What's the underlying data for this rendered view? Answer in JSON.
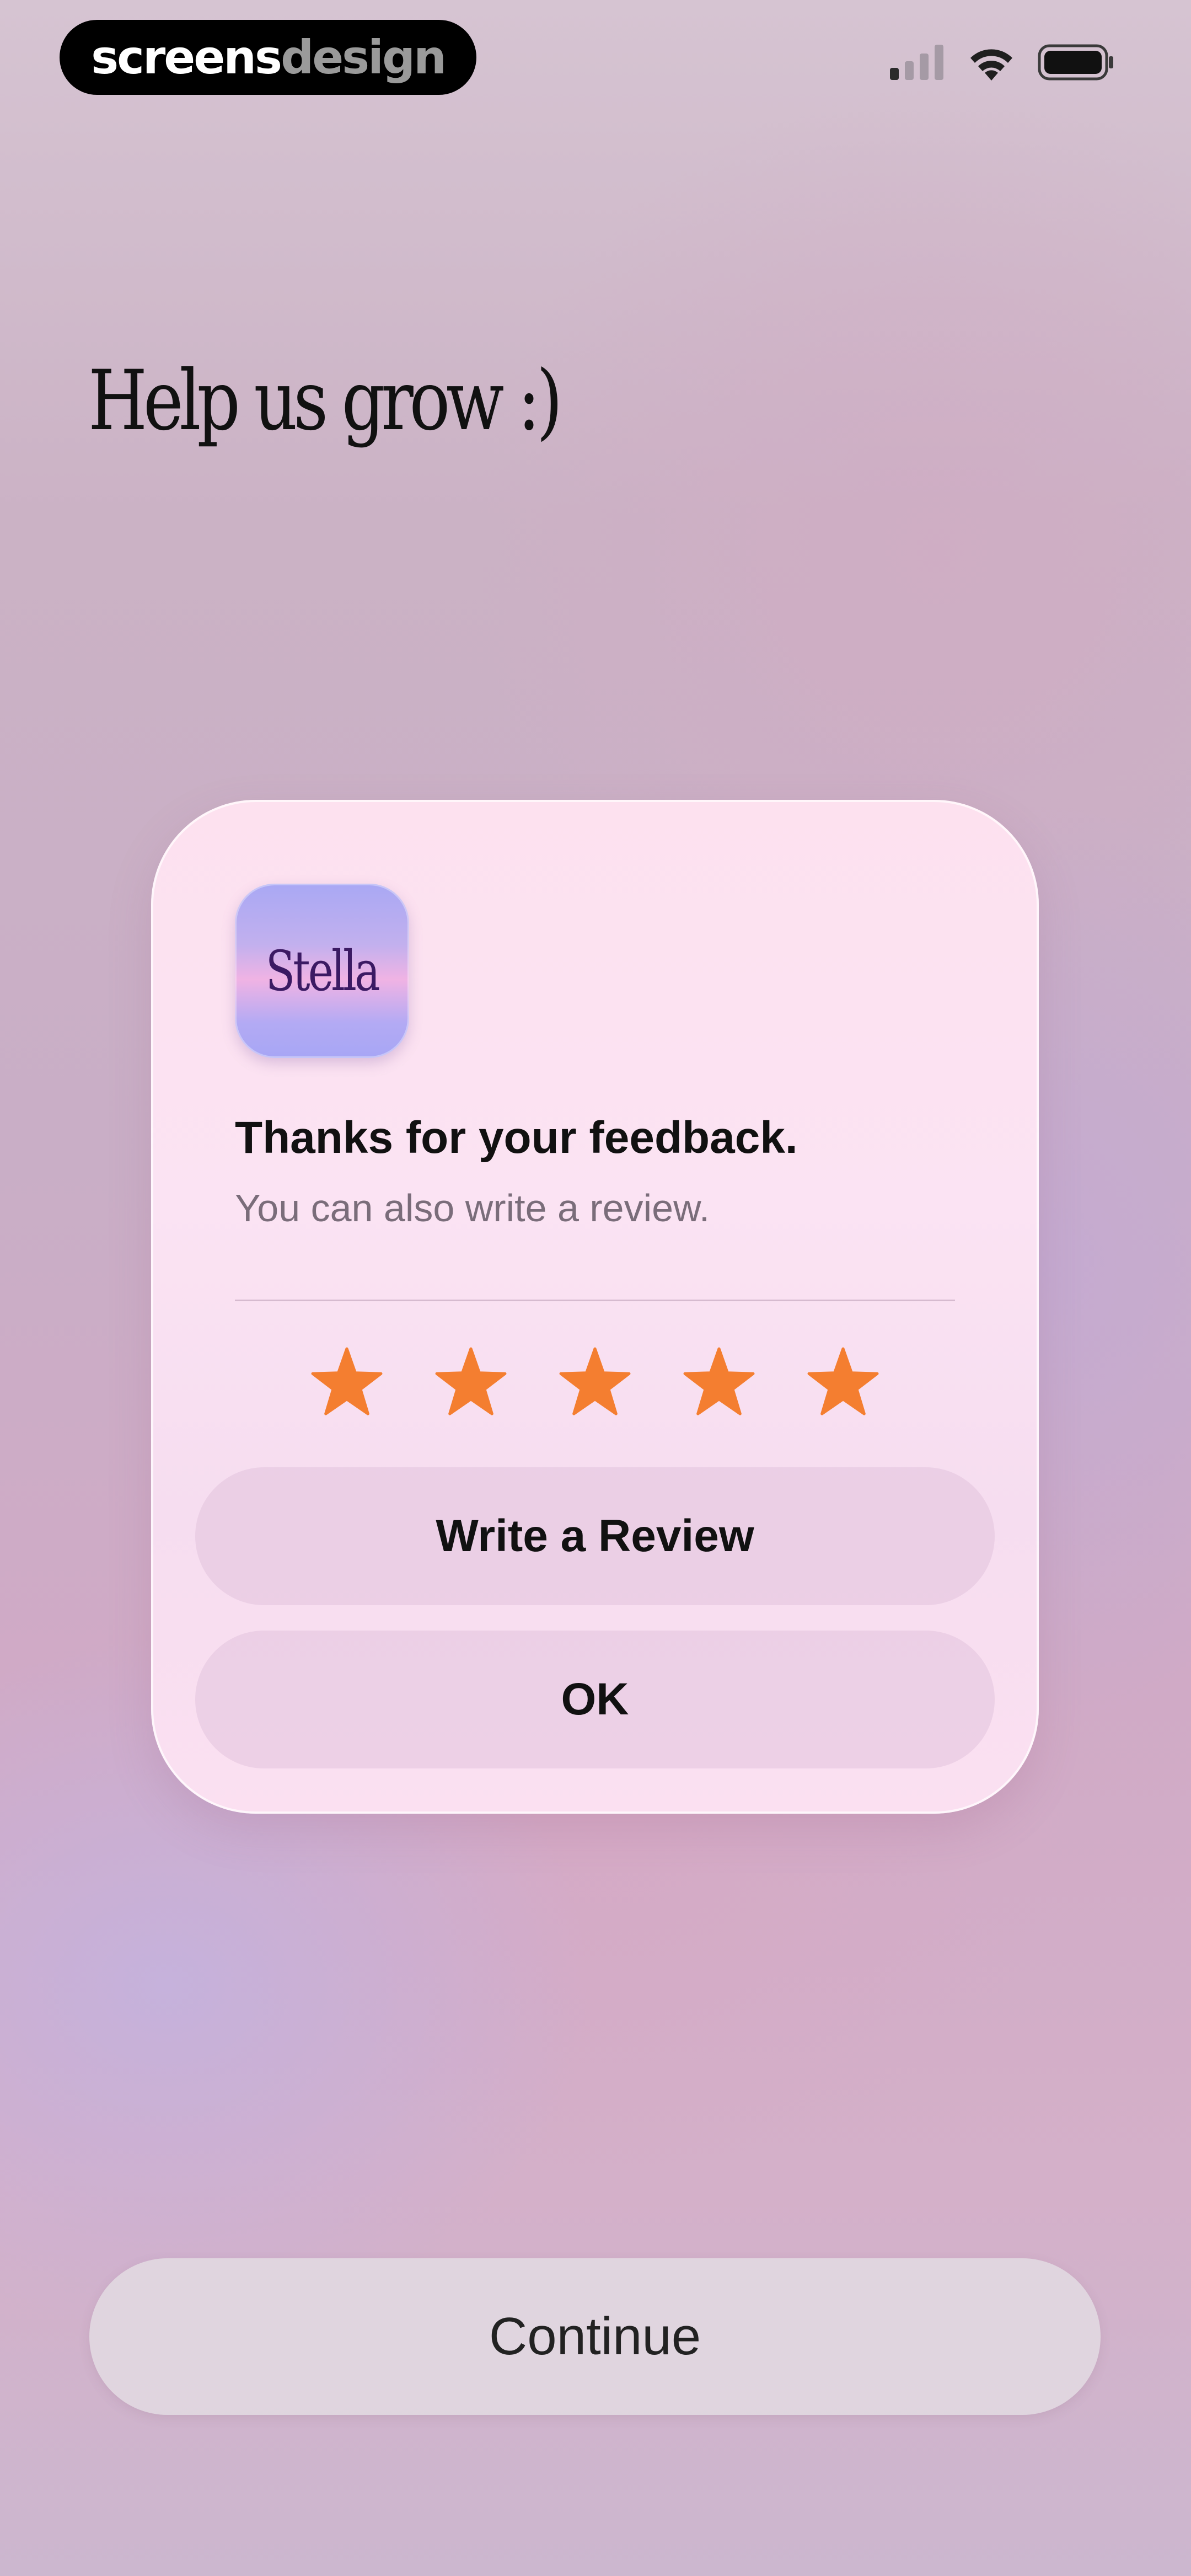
{
  "watermark": {
    "part1": "screens",
    "part2": "design"
  },
  "status_bar": {
    "icons": [
      "cellular-signal-icon",
      "wifi-icon",
      "battery-icon"
    ]
  },
  "page": {
    "title": "Help us grow :)"
  },
  "dialog": {
    "app_icon_text": "Stella",
    "title": "Thanks for your feedback.",
    "subtitle": "You can also write a review.",
    "rating": 5,
    "rating_max": 5,
    "star_color": "#f47e30",
    "write_review_label": "Write a Review",
    "ok_label": "OK"
  },
  "footer": {
    "continue_label": "Continue"
  }
}
